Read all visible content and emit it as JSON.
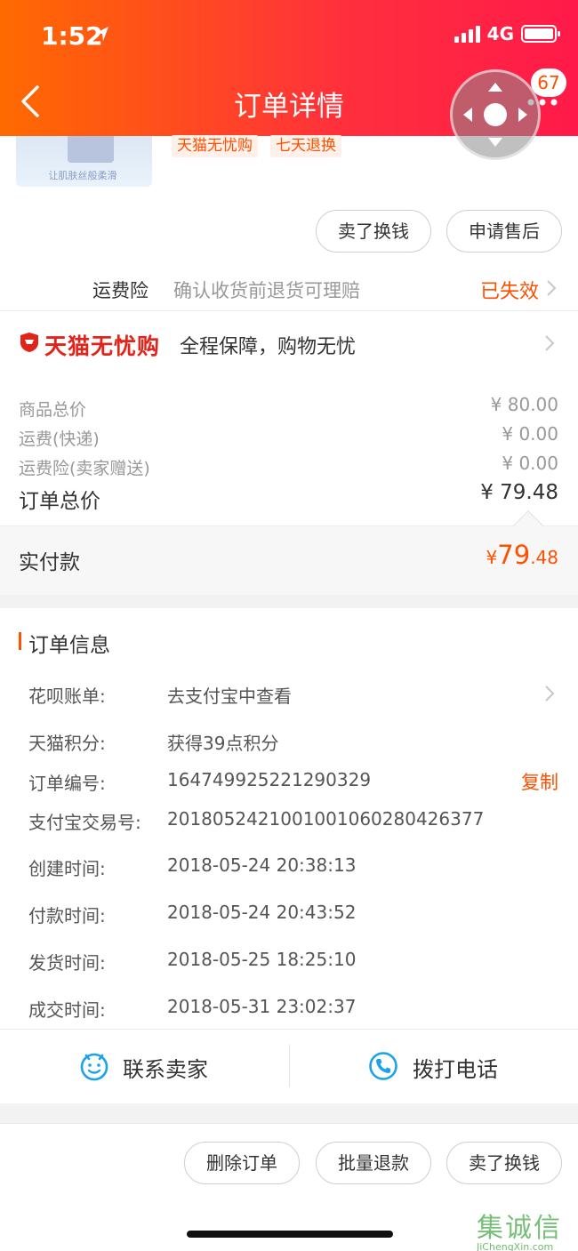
{
  "status_bar": {
    "time": "1:52",
    "network": "4G"
  },
  "header": {
    "title": "订单详情",
    "badge_count": "67"
  },
  "product": {
    "thumb_caption": "让肌肤丝般柔滑",
    "tags": [
      "天猫无忧购",
      "七天退换"
    ]
  },
  "item_actions": {
    "sell_exchange": "卖了换钱",
    "after_sale": "申请售后"
  },
  "shipping_insurance": {
    "label": "运费险",
    "desc": "确认收货前退货可理赔",
    "status": "已失效"
  },
  "guarantee": {
    "brand": "天猫无忧购",
    "desc": "全程保障，购物无忧"
  },
  "price": {
    "rows": [
      {
        "label": "商品总价",
        "value": "¥ 80.00"
      },
      {
        "label": "运费(快递)",
        "value": "¥ 0.00"
      },
      {
        "label": "运费险(卖家赠送)",
        "value": "¥ 0.00"
      }
    ],
    "total_label": "订单总价",
    "total_value": "¥ 79.48",
    "paid_label": "实付款",
    "paid_currency": "¥",
    "paid_integer": "79",
    "paid_decimal": ".48"
  },
  "order_info": {
    "title": "订单信息",
    "rows": [
      {
        "label": "花呗账单:",
        "value": "去支付宝中查看"
      },
      {
        "label": "天猫积分:",
        "value": "获得39点积分"
      },
      {
        "label": "订单编号:",
        "value": "164749925221290329"
      },
      {
        "label": "支付宝交易号:",
        "value": "2018052421001001060280426377"
      },
      {
        "label": "创建时间:",
        "value": "2018-05-24 20:38:13"
      },
      {
        "label": "付款时间:",
        "value": "2018-05-24 20:43:52"
      },
      {
        "label": "发货时间:",
        "value": "2018-05-25 18:25:10"
      },
      {
        "label": "成交时间:",
        "value": "2018-05-31 23:02:37"
      }
    ],
    "copy_label": "复制"
  },
  "contact": {
    "seller": "联系卖家",
    "call": "拨打电话"
  },
  "bottom_actions": {
    "delete": "删除订单",
    "batch_refund": "批量退款",
    "sell_exchange": "卖了换钱"
  },
  "watermark": {
    "text": "集诚信",
    "url": "JiChengXin.com"
  },
  "colors": {
    "accent": "#ff5000",
    "tmall_red": "#e2231a",
    "contact_blue": "#1aa3e8"
  }
}
